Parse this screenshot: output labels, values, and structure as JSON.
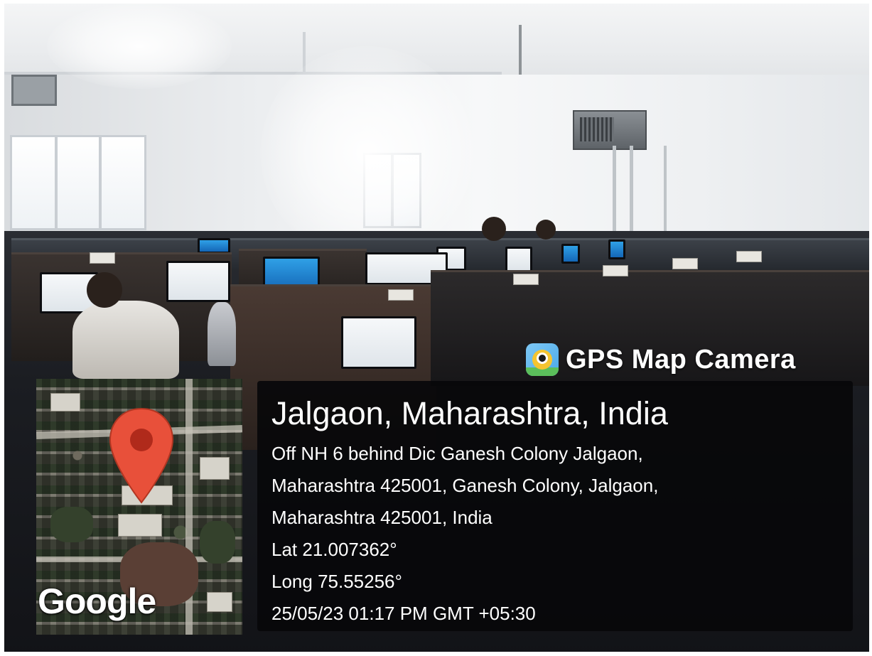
{
  "overlay": {
    "brand_label": "GPS Map Camera",
    "brand_icon": "gps-map-camera-app-icon",
    "map_logo": "Google",
    "map_pin_icon": "map-pin-icon",
    "place_title": "Jalgaon, Maharashtra, India",
    "address_lines": [
      "Off NH 6 behind Dic Ganesh Colony Jalgaon,",
      "Maharashtra 425001, Ganesh Colony, Jalgaon,",
      "Maharashtra 425001, India"
    ],
    "latitude": "Lat 21.007362°",
    "longitude": "Long 75.55256°",
    "timestamp": "25/05/23 01:17 PM GMT +05:30"
  },
  "colors": {
    "panel_background": "#08080a",
    "pin_red": "#e8503a",
    "text": "#ffffff"
  }
}
